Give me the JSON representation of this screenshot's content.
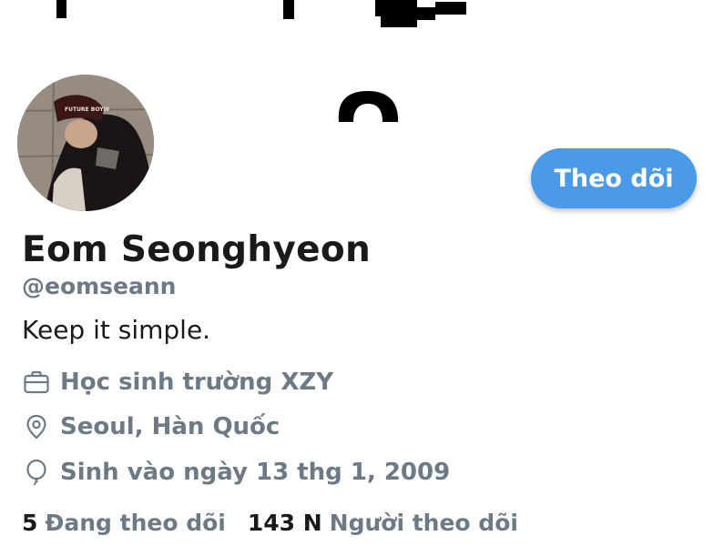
{
  "profile": {
    "display_name": "Eom Seonghyeon",
    "handle": "@eomseann",
    "bio": "Keep it simple.",
    "work": "Học sinh trường XZY",
    "location": "Seoul, Hàn Quốc",
    "birthday": "Sinh vào ngày 13 thg 1, 2009",
    "avatar_cap_text": "FUTURE BOYW"
  },
  "actions": {
    "follow_label": "Theo dõi"
  },
  "stats": {
    "following_count": "5",
    "following_label": "Đang theo dõi",
    "followers_count": "143 N",
    "followers_label": "Người theo dõi"
  },
  "icons": {
    "work": "briefcase-icon",
    "location": "location-pin-icon",
    "birthday": "balloon-icon"
  },
  "colors": {
    "accent": "#4a9ae8",
    "text_primary": "#1a1a1a",
    "text_secondary": "#6d7a86"
  }
}
